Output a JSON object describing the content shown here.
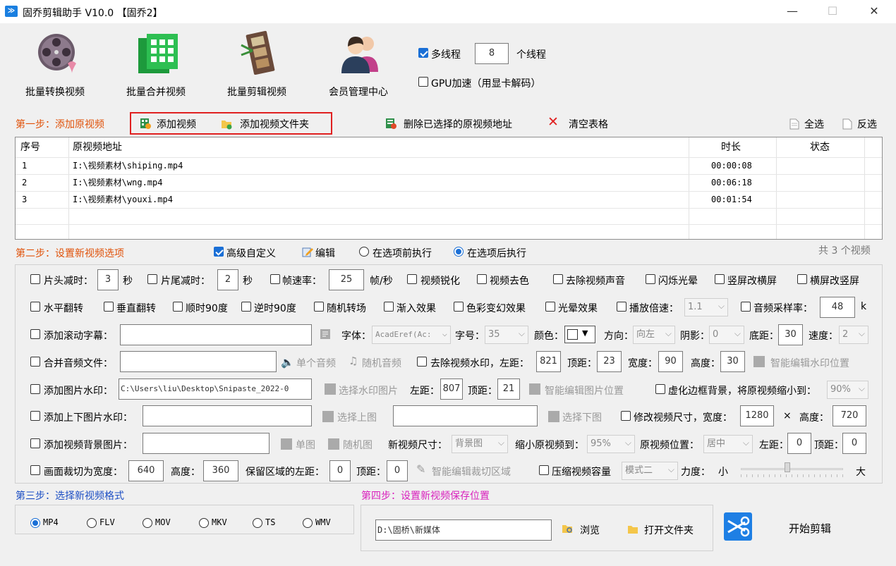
{
  "window": {
    "title": "固乔剪辑助手 V10.0 【固乔2】",
    "minimize": "—",
    "maximize": "☐",
    "close": "✕"
  },
  "toolbar": {
    "convert": "批量转换视频",
    "merge": "批量合并视频",
    "edit": "批量剪辑视频",
    "member": "会员管理中心",
    "multithread_label": "多线程",
    "thread_count": "8",
    "thread_unit": "个线程",
    "gpu_label": "GPU加速（用显卡解码）"
  },
  "step1": {
    "label": "第一步：添加原视频",
    "add_video": "添加视频",
    "add_folder": "添加视频文件夹",
    "delete_selected": "删除已选择的原视频地址",
    "clear_table": "清空表格",
    "select_all": "全选",
    "invert": "反选"
  },
  "table": {
    "headers": {
      "index": "序号",
      "path": "原视频地址",
      "duration": "时长",
      "status": "状态"
    },
    "rows": [
      {
        "index": "1",
        "path": "I:\\视频素材\\shiping.mp4",
        "duration": "00:00:08",
        "status": ""
      },
      {
        "index": "2",
        "path": "I:\\视频素材\\wng.mp4",
        "duration": "00:06:18",
        "status": ""
      },
      {
        "index": "3",
        "path": "I:\\视频素材\\youxi.mp4",
        "duration": "00:01:54",
        "status": ""
      }
    ]
  },
  "step2": {
    "label": "第二步：设置新视频选项",
    "advanced": "高级自定义",
    "edit": "编辑",
    "before": "在选项前执行",
    "after": "在选项后执行",
    "count": "共 3 个视频"
  },
  "options": {
    "row1": {
      "head_cut": "片头减时：",
      "head_val": "3",
      "sec1": "秒",
      "tail_cut": "片尾减时：",
      "tail_val": "2",
      "sec2": "秒",
      "fps": "帧速率：",
      "fps_val": "25",
      "fps_unit": "帧/秒",
      "sharpen": "视频锐化",
      "decolor": "视频去色",
      "mute": "去除视频声音",
      "flash": "闪烁光晕",
      "v2h": "竖屏改横屏",
      "h2v": "横屏改竖屏"
    },
    "row2": {
      "hflip": "水平翻转",
      "vflip": "垂直翻转",
      "cw90": "顺时90度",
      "ccw90": "逆时90度",
      "transition": "随机转场",
      "fadein": "渐入效果",
      "colorfx": "色彩变幻效果",
      "halo": "光晕效果",
      "speed": "播放倍速：",
      "speed_val": "1.1",
      "samplerate": "音频采样率：",
      "samplerate_val": "48",
      "samplerate_unit": "k"
    },
    "row3": {
      "scroll_text": "添加滚动字幕：",
      "font": "字体：",
      "font_val": "AcadEref(Ac:",
      "size": "字号：",
      "size_val": "35",
      "color": "颜色：",
      "direction": "方向：",
      "direction_val": "向左",
      "shadow": "阴影：",
      "shadow_val": "0",
      "bottom": "底距：",
      "bottom_val": "30",
      "speed": "速度：",
      "speed_val": "2"
    },
    "row4": {
      "merge_audio": "合并音频文件：",
      "single_audio": "单个音频",
      "random_audio": "随机音频",
      "remove_wm": "去除视频水印，左距：",
      "left_val": "821",
      "top": "顶距：",
      "top_val": "23",
      "width": "宽度：",
      "width_val": "90",
      "height": "高度：",
      "height_val": "30",
      "smart_wm": "智能编辑水印位置"
    },
    "row5": {
      "img_wm": "添加图片水印：",
      "img_path": "C:\\Users\\liu\\Desktop\\Snipaste_2022-0",
      "choose_img": "选择水印图片",
      "left": "左距：",
      "left_val": "807",
      "top": "顶距：",
      "top_val": "21",
      "smart_img": "智能编辑图片位置",
      "blur_border": "虚化边框背景，将原视频缩小到：",
      "blur_val": "90%"
    },
    "row6": {
      "topbottom_wm": "添加上下图片水印：",
      "choose_top": "选择上图",
      "choose_bottom": "选择下图",
      "resize": "修改视频尺寸，宽度：",
      "width_val": "1280",
      "times": "×",
      "height": "高度：",
      "height_val": "720"
    },
    "row7": {
      "bg_img": "添加视频背景图片：",
      "single": "单图",
      "random": "随机图",
      "new_size": "新视频尺寸：",
      "new_size_val": "背景图",
      "shrink": "缩小原视频到：",
      "shrink_val": "95%",
      "position": "原视频位置：",
      "position_val": "居中",
      "left": "左距：",
      "left_val": "0",
      "top": "顶距：",
      "top_val": "0"
    },
    "row8": {
      "crop": "画面裁切为宽度：",
      "crop_w": "640",
      "height": "高度：",
      "crop_h": "360",
      "keep_left": "保留区域的左距：",
      "left_val": "0",
      "top": "顶距：",
      "top_val": "0",
      "smart_crop": "智能编辑裁切区域",
      "compress": "压缩视频容量",
      "mode_val": "模式二",
      "strength": "力度：",
      "small": "小",
      "large": "大",
      "strength_level": 0.45
    }
  },
  "step3": {
    "label": "第三步：选择新视频格式",
    "formats": [
      "MP4",
      "FLV",
      "MOV",
      "MKV",
      "TS",
      "WMV"
    ]
  },
  "step4": {
    "label": "第四步：设置新视频保存位置",
    "path": "D:\\固桥\\新媒体",
    "browse": "浏览",
    "open_folder": "打开文件夹",
    "start": "开始剪辑"
  },
  "colors": {
    "accent": "#1a6fd6",
    "step_orange": "#e0520a",
    "step_blue": "#1d4fc4",
    "step_pink": "#d91fbd",
    "highlight_box": "#e02020"
  }
}
